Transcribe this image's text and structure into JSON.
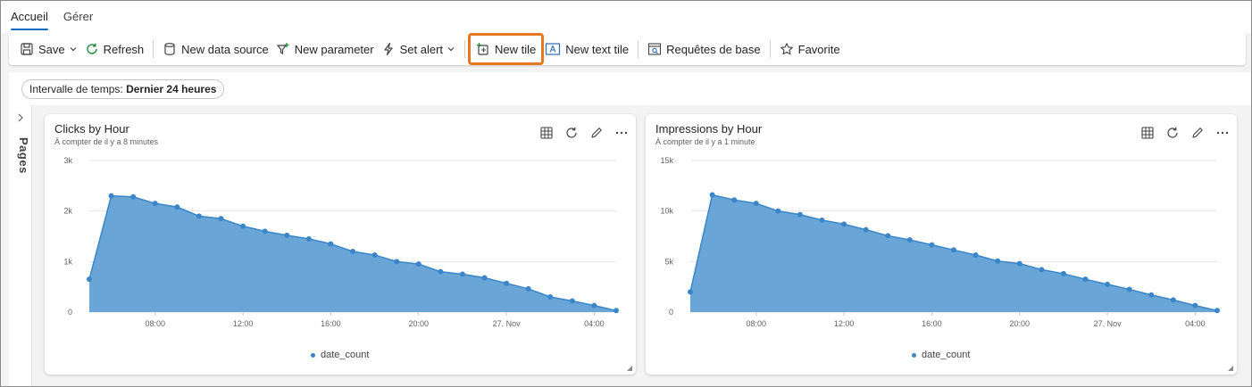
{
  "tabs": [
    {
      "label": "Accueil",
      "active": true
    },
    {
      "label": "Gérer",
      "active": false
    }
  ],
  "toolbar": {
    "save": "Save",
    "refresh": "Refresh",
    "new_data_source": "New data source",
    "new_parameter": "New parameter",
    "set_alert": "Set alert",
    "new_tile": "New tile",
    "new_text_tile": "New text tile",
    "requetes": "Requêtes de base",
    "favorite": "Favorite",
    "highlight_color": "#e87722"
  },
  "filter": {
    "label": "Intervalle de temps: ",
    "value": "Dernier 24 heures"
  },
  "pages_rail": {
    "label": "Pages"
  },
  "colors": {
    "accent": "#0f6cbd",
    "area_fill": "#6aa5d8",
    "line": "#3a86c8"
  },
  "tiles": [
    {
      "title": "Clicks by Hour",
      "subtitle": "À compter de il y a 8 minutes",
      "legend": "date_count"
    },
    {
      "title": "Impressions by Hour",
      "subtitle": "À compter de il y a 1 minute",
      "legend": "date_count"
    }
  ],
  "chart_data": [
    {
      "type": "area",
      "ytick_labels": [
        "0",
        "1k",
        "2k",
        "3k"
      ],
      "ylim": [
        0,
        3000
      ],
      "yticks": [
        0,
        1000,
        2000,
        3000
      ],
      "xtick_labels": [
        "08:00",
        "12:00",
        "16:00",
        "20:00",
        "27. Nov",
        "04:00"
      ],
      "xtick_positions": [
        3,
        7,
        11,
        15,
        19,
        23
      ],
      "x_count": 25,
      "grid": true,
      "legend_position": "bottom",
      "series": [
        {
          "name": "date_count",
          "values": [
            650,
            2300,
            2280,
            2150,
            2080,
            1900,
            1850,
            1700,
            1600,
            1520,
            1450,
            1350,
            1200,
            1130,
            1000,
            950,
            800,
            750,
            680,
            570,
            460,
            300,
            220,
            130,
            30
          ]
        }
      ]
    },
    {
      "type": "area",
      "ytick_labels": [
        "0",
        "5k",
        "10k",
        "15k"
      ],
      "ylim": [
        0,
        15000
      ],
      "yticks": [
        0,
        5000,
        10000,
        15000
      ],
      "xtick_labels": [
        "08:00",
        "12:00",
        "16:00",
        "20:00",
        "27. Nov",
        "04:00"
      ],
      "xtick_positions": [
        3,
        7,
        11,
        15,
        19,
        23
      ],
      "x_count": 25,
      "grid": true,
      "legend_position": "bottom",
      "series": [
        {
          "name": "date_count",
          "values": [
            2000,
            11600,
            11100,
            10750,
            10000,
            9650,
            9100,
            8700,
            8150,
            7550,
            7150,
            6650,
            6150,
            5650,
            5050,
            4800,
            4200,
            3800,
            3250,
            2750,
            2250,
            1700,
            1200,
            650,
            150
          ]
        }
      ]
    }
  ]
}
